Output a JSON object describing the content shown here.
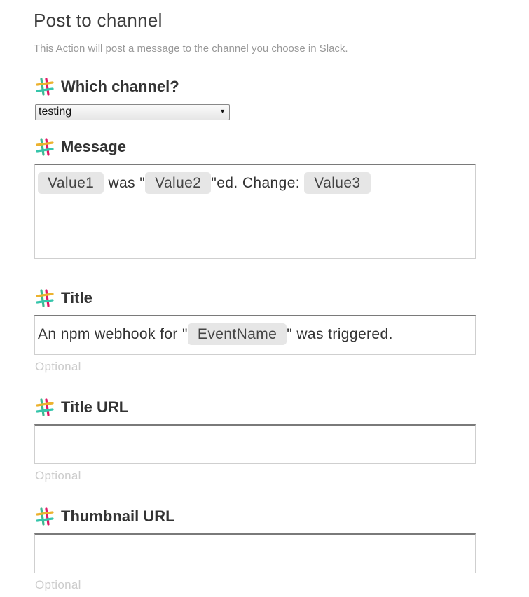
{
  "header": {
    "title": "Post to channel",
    "description": "This Action will post a message to the channel you choose in Slack."
  },
  "fields": {
    "channel": {
      "label": "Which channel?",
      "icon": "slack-icon",
      "selected_value": "testing"
    },
    "message": {
      "label": "Message",
      "icon": "slack-icon",
      "tokens": [
        "Value1",
        "Value2",
        "Value3"
      ],
      "text_was": " was \"",
      "text_ed_change": "\"ed. Change: "
    },
    "title": {
      "label": "Title",
      "icon": "slack-icon",
      "prefix": "An npm webhook for \"",
      "token": "EventName",
      "suffix": "\" was triggered.",
      "hint": "Optional"
    },
    "title_url": {
      "label": "Title URL",
      "icon": "slack-icon",
      "value": "",
      "hint": "Optional"
    },
    "thumbnail_url": {
      "label": "Thumbnail URL",
      "icon": "slack-icon",
      "value": "",
      "hint": "Optional"
    }
  },
  "colors": {
    "slack_teal": "#36C5AB",
    "slack_yellow": "#ECB22E",
    "slack_green": "#3EB890",
    "slack_red": "#E01765",
    "slack_purple": "#4A154B",
    "pill_bg": "#e6e6e6",
    "hint_text": "#cccccc"
  }
}
